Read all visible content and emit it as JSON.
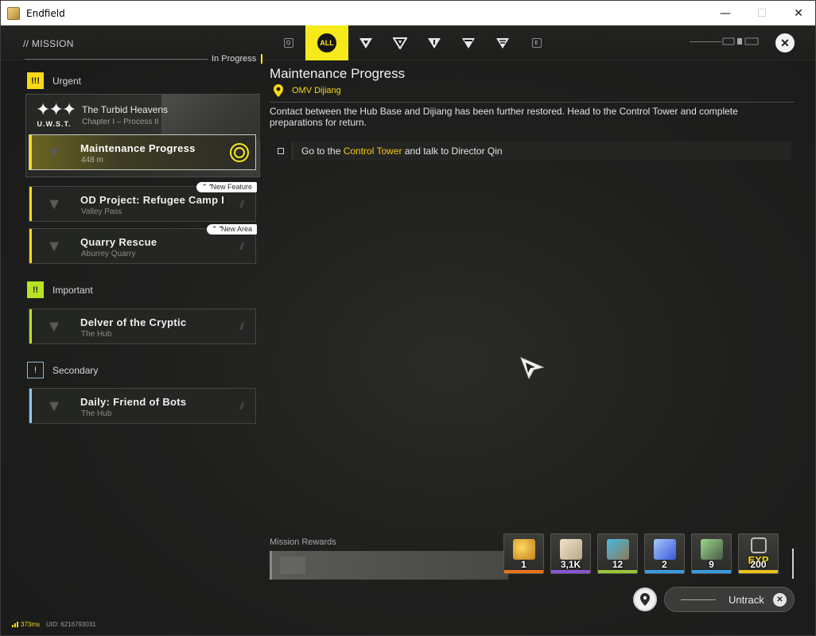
{
  "window": {
    "title": "Endfield",
    "minimize": "—",
    "maximize": "☐",
    "close": "✕"
  },
  "header": {
    "section_title": "// MISSION",
    "filter_tabs": [
      {
        "icon": "key-q-icon",
        "label": "Q"
      },
      {
        "icon": "all-icon",
        "label": "ALL"
      },
      {
        "icon": "urgent-filter-icon",
        "label": ""
      },
      {
        "icon": "important-filter-icon",
        "label": ""
      },
      {
        "icon": "story-filter-icon",
        "label": ""
      },
      {
        "icon": "exploration-filter-icon",
        "label": ""
      },
      {
        "icon": "secondary-filter-icon",
        "label": ""
      },
      {
        "icon": "key-e-icon",
        "label": "E"
      }
    ],
    "close_icon": "close-icon"
  },
  "list": {
    "in_progress_label": "In Progress",
    "sections": {
      "urgent": {
        "label": "Urgent",
        "icon": "!!!"
      },
      "important": {
        "label": "Important",
        "icon": "!!"
      },
      "secondary": {
        "label": "Secondary",
        "icon": "!"
      }
    },
    "chapter": {
      "logo_text": "U.W.S.T.",
      "title": "The Turbid Heavens",
      "subtitle": "Chapter I – Process II"
    },
    "missions": [
      {
        "title": "Maintenance Progress",
        "subtitle": "448 m",
        "tag": "",
        "stripe": "#f6d917",
        "active": true
      },
      {
        "title": "OD Project: Refugee Camp I",
        "subtitle": "Valley Pass",
        "tag": "New Feature",
        "stripe": "#f6d917",
        "active": false
      },
      {
        "title": "Quarry Rescue",
        "subtitle": "Aburrey Quarry",
        "tag": "New Area",
        "stripe": "#f6d917",
        "active": false
      },
      {
        "title": "Delver of the Cryptic",
        "subtitle": "The Hub",
        "tag": "",
        "stripe": "#b7e327",
        "active": false
      },
      {
        "title": "Daily: Friend of Bots",
        "subtitle": "The Hub",
        "tag": "",
        "stripe": "#8fc9f0",
        "active": false
      }
    ]
  },
  "detail": {
    "title": "Maintenance Progress",
    "location": "OMV Dijiang",
    "description": "Contact between the Hub Base and Dijiang has been further restored. Head to the Control Tower and complete preparations for return.",
    "objective": {
      "before": "Go to the ",
      "highlight": "Control Tower",
      "after": " and talk to Director Qin"
    }
  },
  "rewards": {
    "label": "Mission Rewards",
    "items": [
      {
        "qty": "1",
        "strip": "#e8731a",
        "art": "#d9a020",
        "icon": "gold-crystal-icon"
      },
      {
        "qty": "3,1K",
        "strip": "#8a54d4",
        "art": "#d8c8a8",
        "icon": "currency-notes-icon"
      },
      {
        "qty": "12",
        "strip": "#9ac43a",
        "art": "#8a7a5a",
        "icon": "ticket-icon"
      },
      {
        "qty": "2",
        "strip": "#3a9ae0",
        "art": "#6a8ee0",
        "icon": "blue-crystal-icon"
      },
      {
        "qty": "9",
        "strip": "#3a9ae0",
        "art": "#6a7a6a",
        "icon": "component-icon"
      },
      {
        "qty": "200",
        "strip": "#e8c21a",
        "art": "#555",
        "exp": "EXP",
        "icon": "exp-icon"
      }
    ]
  },
  "actions": {
    "untrack_label": "Untrack"
  },
  "footer": {
    "ping": "373ms",
    "uid": "UID: 6216793031"
  }
}
